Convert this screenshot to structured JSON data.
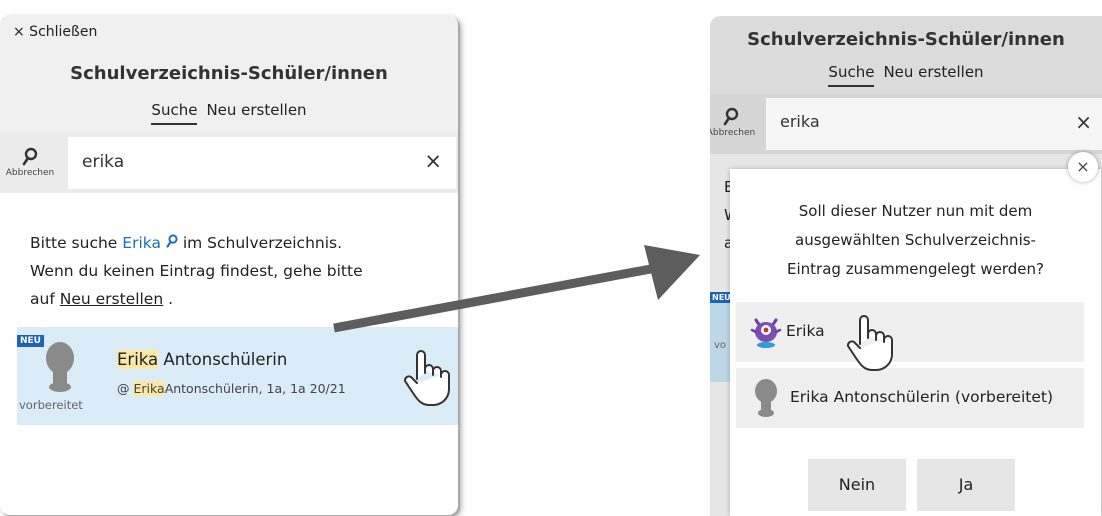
{
  "left": {
    "close_label": "× Schließen",
    "title": "Schulverzeichnis-Schüler/innen",
    "tabs": [
      "Suche",
      "Neu erstellen"
    ],
    "search": {
      "button_label": "Abbrechen",
      "value": "erika",
      "clear": "×"
    },
    "hint": {
      "part1": "Bitte suche",
      "name_link": "Erika",
      "part2": "im Schulverzeichnis.",
      "line2": "Wenn du keinen Eintrag findest, gehe bitte",
      "part3": "auf",
      "create_link": "Neu erstellen",
      "end": "."
    },
    "result": {
      "badge": "NEU",
      "status": "vorbereitet",
      "name_highlight": "Erika",
      "name_rest": "Antonschülerin",
      "sub_prefix": "@ ",
      "sub_highlight": "Erika",
      "sub_rest": "Antonschülerin, 1a, 1a 20/21"
    }
  },
  "right": {
    "title": "Schulverzeichnis-Schüler/innen",
    "tabs": [
      "Suche",
      "Neu erstellen"
    ],
    "search": {
      "button_label": "Abbrechen",
      "value": "erika",
      "clear": "×"
    },
    "peek": [
      "E",
      "W",
      "a",
      "vo"
    ],
    "peek_badge": "NEU",
    "dialog": {
      "close": "×",
      "question_lines": [
        "Soll dieser Nutzer nun mit dem",
        "ausgewählten Schulverzeichnis-",
        "Eintrag zusammengelegt werden?"
      ],
      "choices": [
        "Erika",
        "Erika Antonschülerin (vorbereitet)"
      ],
      "no_label": "Nein",
      "yes_label": "Ja"
    }
  },
  "colors": {
    "accent_blue": "#1a63b8",
    "link_blue": "#1e6fc0",
    "highlight": "#fbe8a6",
    "row_blue": "#d9ecf7"
  },
  "icons": [
    "search-icon",
    "close-icon",
    "avatar-placeholder-icon",
    "monster-avatar-icon",
    "hand-pointer-icon",
    "arrow-icon"
  ]
}
